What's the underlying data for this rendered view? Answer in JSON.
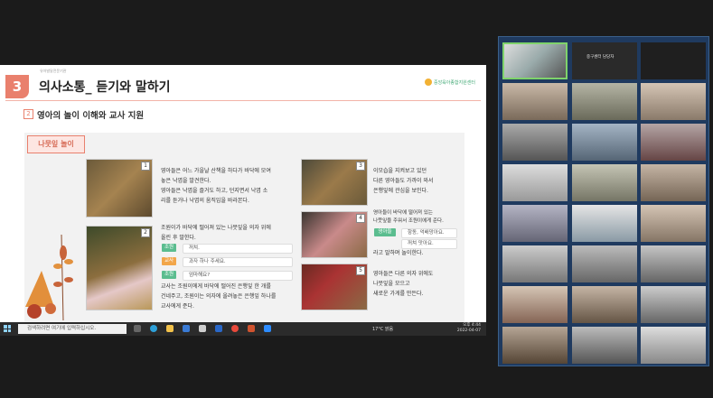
{
  "slide": {
    "section_number": "3",
    "caption": "유아발달전문기관",
    "title": "의사소통_ 듣기와 말하기",
    "logo_text": "중앙육아종합지원센터",
    "subsection_number": "2",
    "subtitle": "영아의 놀이 이해와 교사 지원",
    "tag": "나뭇잎 놀이",
    "photos": [
      "1",
      "2",
      "3",
      "4",
      "5"
    ],
    "text1": [
      "영아들은 어느 가을날 산책을 하다가 바닥에 모여",
      "놓은 낙엽을 발견한다.",
      "영아들은 낙엽을 즐거도 하고, 던지면서 낙엽 소",
      "리를 듣거나 낙엽의 움직임을 바라본다."
    ],
    "text2": [
      "조원이가 바닥에 떨어져 있는 나뭇잎을 의자 위에",
      "올린 후 말한다."
    ],
    "dialog": [
      {
        "who": "조원",
        "line": "꺼쳐."
      },
      {
        "who": "교사",
        "line": "과자 하나 주세요."
      },
      {
        "who": "조원",
        "line": "엄마해요?"
      }
    ],
    "text3": [
      "교사는 조원이에게 바닥에 떨어진 은행잎 한 개를",
      "건네주고, 조원이는 의자에 올려놓은 은행잎 하나를",
      "교사에게 준다."
    ],
    "text4": [
      "이모습을 지켜보고 있던",
      "다른 영아들도 가까이 와서",
      "은행잎에 관심을 보인다."
    ],
    "text5": [
      "영아들이 바닥에 떨어져 있는",
      "나뭇잎을 주워서 조원이에게 준다."
    ],
    "dialog2": {
      "who": "영아들",
      "lines": [
        "항동, 억배망아요.",
        "꺼쳐 맛아요."
      ]
    },
    "text5b": "라고 말하며 놀이한다.",
    "text6": [
      "영아들은 다른 의자 위에도",
      "나뭇잎을 모으고",
      "새로운 가게를 만든다."
    ]
  },
  "taskbar": {
    "search_placeholder": "검색하려면 여기에 입력하십시오.",
    "weather": "17°C 맑음",
    "time": "오후 4:44",
    "date": "2022-04-07"
  },
  "gallery": {
    "tiles": [
      {
        "label": "",
        "speaking": true
      },
      {
        "label": "중구센터 담당자",
        "speaking": false
      },
      {
        "label": "",
        "speaking": false
      },
      {
        "label": "",
        "speaking": false
      },
      {
        "label": "",
        "speaking": false
      },
      {
        "label": "",
        "speaking": false
      }
    ]
  }
}
